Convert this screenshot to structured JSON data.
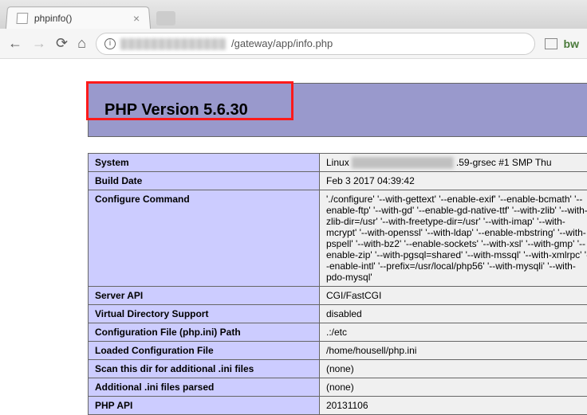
{
  "tab": {
    "title": "phpinfo()"
  },
  "url": {
    "path": "/gateway/app/info.php"
  },
  "header": {
    "title": "PHP Version 5.6.30"
  },
  "rows": [
    {
      "key": "System",
      "val": "Linux                                                  .59-grsec #1 SMP Thu",
      "blurred": true
    },
    {
      "key": "Build Date",
      "val": "Feb 3 2017 04:39:42"
    },
    {
      "key": "Configure Command",
      "val": "'./configure' '--with-gettext' '--enable-exif' '--enable-bcmath' '--enable-ftp' '--with-gd' '--enable-gd-native-ttf' '--with-zlib' '--with-zlib-dir=/usr' '--with-freetype-dir=/usr' '--with-imap' '--with-mcrypt' '--with-openssl' '--with-ldap' '--enable-mbstring' '--with-pspell' '--with-bz2' '--enable-sockets' '--with-xsl' '--with-gmp' '--enable-zip' '--with-pgsql=shared' '--with-mssql' '--with-xmlrpc' '--enable-intl' '--prefix=/usr/local/php56' '--with-mysqli' '--with-pdo-mysql'"
    },
    {
      "key": "Server API",
      "val": "CGI/FastCGI"
    },
    {
      "key": "Virtual Directory Support",
      "val": "disabled"
    },
    {
      "key": "Configuration File (php.ini) Path",
      "val": ".:/etc"
    },
    {
      "key": "Loaded Configuration File",
      "val": "/home/housell/php.ini"
    },
    {
      "key": "Scan this dir for additional .ini files",
      "val": "(none)"
    },
    {
      "key": "Additional .ini files parsed",
      "val": "(none)"
    },
    {
      "key": "PHP API",
      "val": "20131106"
    }
  ]
}
